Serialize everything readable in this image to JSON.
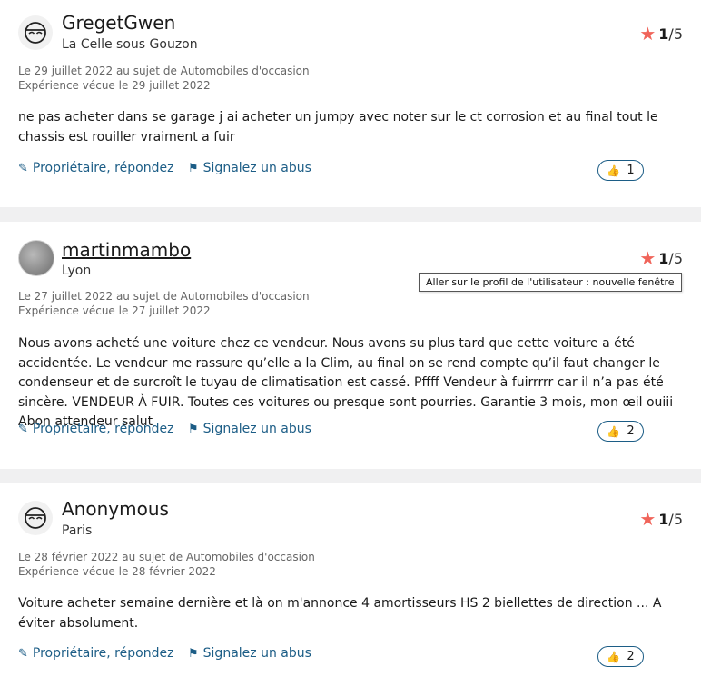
{
  "reviews": [
    {
      "user": "GregetGwen",
      "location": "La Celle sous Gouzon",
      "rating": "1",
      "rating_max": "/5",
      "date": "Le 29 juillet 2022 au sujet de Automobiles d'occasion",
      "experience": "Expérience vécue le 29 juillet 2022",
      "text": "ne pas acheter dans se garage j ai acheter un jumpy avec noter sur le ct corrosion et au final tout le chassis est rouiller vraiment a fuir",
      "reply": "Propriétaire, répondez",
      "report": "Signalez un abus",
      "useful_count": "1"
    },
    {
      "user": "martinmambo",
      "location": "Lyon",
      "rating": "1",
      "rating_max": "/5",
      "date": "Le 27 juillet 2022 au sujet de Automobiles d'occasion",
      "experience": "Expérience vécue le 27 juillet 2022",
      "text": "Nous avons acheté une voiture chez ce vendeur. Nous avons su plus tard que cette voiture a été accidentée. Le vendeur me rassure qu’elle a la Clim, au final on se rend compte qu’il faut changer le condenseur et de surcroît le tuyau de climatisation est cassé. Pffff Vendeur à fuirrrrr car il n’a pas été sincère. VENDEUR À FUIR. Toutes ces voitures ou presque sont pourries. Garantie 3 mois, mon œil ouiii Abon attendeur salut",
      "reply": "Propriétaire, répondez",
      "report": "Signalez un abus",
      "useful_count": "2"
    },
    {
      "user": "Anonymous",
      "location": "Paris",
      "rating": "1",
      "rating_max": "/5",
      "date": "Le 28 février 2022 au sujet de Automobiles d'occasion",
      "experience": "Expérience vécue le 28 février 2022",
      "text": "Voiture acheter semaine dernière et là on m'annonce 4 amortisseurs HS 2 biellettes de direction ... A éviter absolument.",
      "reply": "Propriétaire, répondez",
      "report": "Signalez un abus",
      "useful_count": "2"
    }
  ],
  "tooltip": "Aller sur le profil de l'utilisateur :  nouvelle fenêtre",
  "icons": {
    "avatar": "user-face-icon",
    "star": "star-icon",
    "reply": "pencil-icon",
    "report": "flag-icon",
    "useful": "thumbs-up-icon"
  },
  "colors": {
    "link": "#1c5d86",
    "star": "#f0645a",
    "separator": "#f0f0f1"
  }
}
